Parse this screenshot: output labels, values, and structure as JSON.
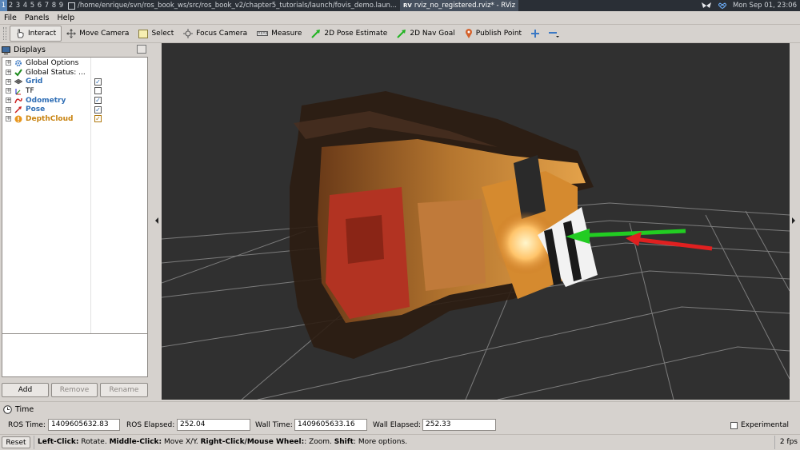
{
  "top_panel": {
    "workspaces": [
      "1",
      "2",
      "3",
      "4",
      "5",
      "6",
      "7",
      "8",
      "9"
    ],
    "active_workspace": "1",
    "terminal_window_title": "/home/enrique/svn/ros_book_ws/src/ros_book_v2/chapter5_tutorials/launch/fovis_demo.laun...",
    "rviz_window_title": "rviz_no_registered.rviz* - RViz",
    "clock": "Mon Sep 01, 23:06"
  },
  "menubar": {
    "file": "File",
    "panels": "Panels",
    "help": "Help"
  },
  "toolbar": {
    "interact": "Interact",
    "move_camera": "Move Camera",
    "select": "Select",
    "focus_camera": "Focus Camera",
    "measure": "Measure",
    "pose_estimate": "2D Pose Estimate",
    "nav_goal": "2D Nav Goal",
    "publish_point": "Publish Point"
  },
  "displays_panel": {
    "title": "Displays",
    "items": [
      {
        "label": "Global Options",
        "icon": "gear-icon",
        "checkbox": null
      },
      {
        "label": "Global Status: ...",
        "icon": "check-icon",
        "checkbox": null
      },
      {
        "label": "Grid",
        "icon": "grid-icon",
        "checkbox": true
      },
      {
        "label": "TF",
        "icon": "tf-icon",
        "checkbox": false
      },
      {
        "label": "Odometry",
        "icon": "odometry-icon",
        "checkbox": true
      },
      {
        "label": "Pose",
        "icon": "pose-icon",
        "checkbox": true
      },
      {
        "label": "DepthCloud",
        "icon": "warning-icon",
        "checkbox": true
      }
    ],
    "add_button": "Add",
    "remove_button": "Remove",
    "rename_button": "Rename"
  },
  "time_panel": {
    "title": "Time",
    "ros_time_label": "ROS Time:",
    "ros_time_value": "1409605632.83",
    "ros_elapsed_label": "ROS Elapsed:",
    "ros_elapsed_value": "252.04",
    "wall_time_label": "Wall Time:",
    "wall_time_value": "1409605633.16",
    "wall_elapsed_label": "Wall Elapsed:",
    "wall_elapsed_value": "252.33",
    "experimental_label": "Experimental",
    "experimental_checked": false
  },
  "statusbar": {
    "reset_button": "Reset",
    "help_1_bold": "Left-Click:",
    "help_1": " Rotate. ",
    "help_2_bold": "Middle-Click:",
    "help_2": " Move X/Y. ",
    "help_3_bold": "Right-Click/Mouse Wheel:",
    "help_3": ": Zoom. ",
    "help_4_bold": "Shift",
    "help_4": ": More options.",
    "fps": "2 fps"
  },
  "colors": {
    "grid_blue": "#2f6eb5",
    "warning_orange": "#c88310",
    "viewport_bg": "#303030",
    "arrow_green": "#22cc22",
    "arrow_red": "#e02020"
  }
}
